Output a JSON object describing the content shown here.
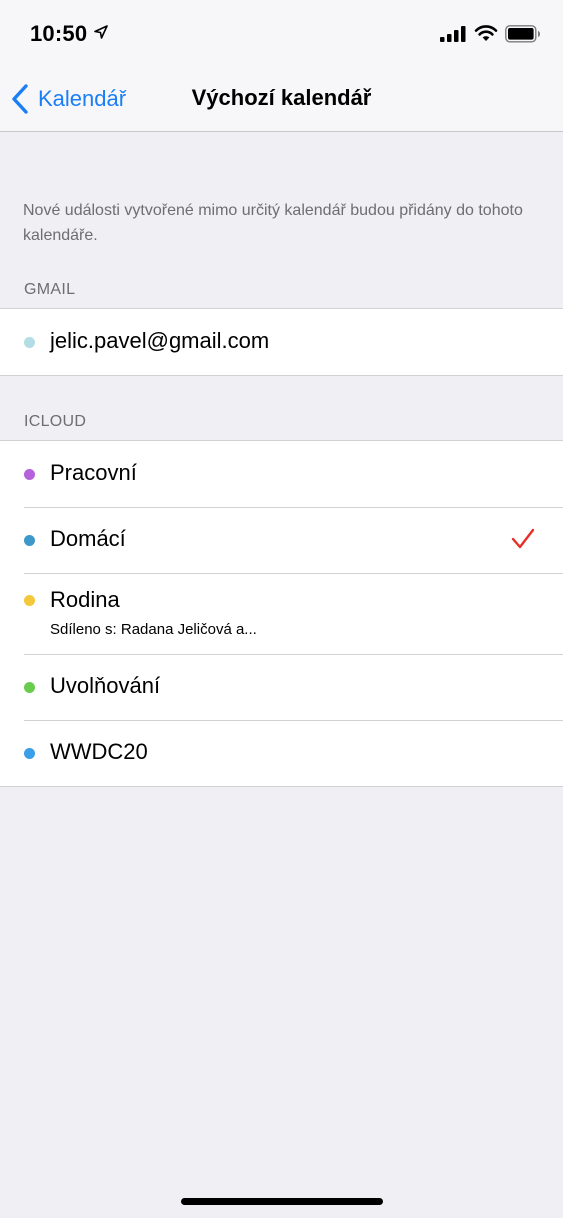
{
  "status_bar": {
    "time": "10:50",
    "icons": [
      "location-arrow-icon",
      "cellular-signal-icon",
      "wifi-icon",
      "battery-icon"
    ]
  },
  "nav": {
    "back_label": "Kalendář",
    "title": "Výchozí kalendář",
    "accent_color": "#1a7ef5"
  },
  "note": "Nové události vytvořené mimo určitý kalendář budou přidány do tohoto kalendáře.",
  "sections": [
    {
      "header": "GMAIL",
      "items": [
        {
          "label": "jelic.pavel@gmail.com",
          "color": "#b3dde5",
          "selected": false
        }
      ]
    },
    {
      "header": "ICLOUD",
      "items": [
        {
          "label": "Pracovní",
          "color": "#b562dc",
          "selected": false
        },
        {
          "label": "Domácí",
          "color": "#3d97c9",
          "selected": true
        },
        {
          "label": "Rodina",
          "subtitle": "Sdíleno s: Radana Jeličová a...",
          "color": "#f3c83a",
          "selected": false
        },
        {
          "label": "Uvolňování",
          "color": "#6acc4e",
          "selected": false
        },
        {
          "label": "WWDC20",
          "color": "#3b9ee8",
          "selected": false
        }
      ]
    }
  ],
  "check_color": "#e5302a"
}
